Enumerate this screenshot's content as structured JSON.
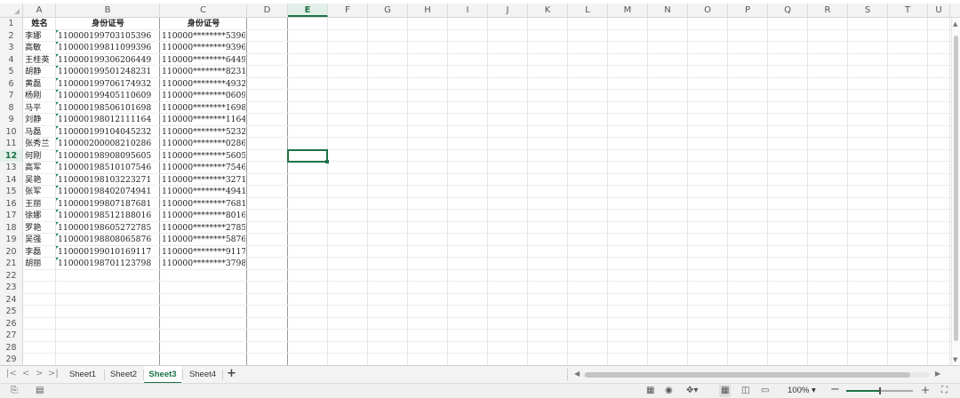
{
  "columns": [
    "A",
    "B",
    "C",
    "D",
    "E",
    "F",
    "G",
    "H",
    "I",
    "J",
    "K",
    "L",
    "M",
    "N",
    "O",
    "P",
    "Q",
    "R",
    "S",
    "T",
    "U"
  ],
  "selected_column": "E",
  "rows": [
    "1",
    "2",
    "3",
    "4",
    "5",
    "6",
    "7",
    "8",
    "9",
    "10",
    "11",
    "12",
    "13",
    "14",
    "15",
    "16",
    "17",
    "18",
    "19",
    "20",
    "21",
    "22",
    "23",
    "24",
    "25",
    "26",
    "27",
    "28",
    "29"
  ],
  "selected_row": "12",
  "headers": {
    "name": "姓名",
    "id_number": "身份证号",
    "masked_id": "身份证号"
  },
  "data_rows": [
    {
      "name": "李娜",
      "id": "110000199703105396",
      "masked": "110000********5396"
    },
    {
      "name": "高敏",
      "id": "110000199811099396",
      "masked": "110000********9396"
    },
    {
      "name": "王桂英",
      "id": "110000199306206449",
      "masked": "110000********6449"
    },
    {
      "name": "胡静",
      "id": "110000199501248231",
      "masked": "110000********8231"
    },
    {
      "name": "黄磊",
      "id": "110000199706174932",
      "masked": "110000********4932"
    },
    {
      "name": "杨刚",
      "id": "110000199405110609",
      "masked": "110000********0609"
    },
    {
      "name": "马平",
      "id": "110000198506101698",
      "masked": "110000********1698"
    },
    {
      "name": "刘静",
      "id": "110000198012111164",
      "masked": "110000********1164"
    },
    {
      "name": "马磊",
      "id": "110000199104045232",
      "masked": "110000********5232"
    },
    {
      "name": "张秀兰",
      "id": "110000200008210286",
      "masked": "110000********0286"
    },
    {
      "name": "何刚",
      "id": "110000198908095605",
      "masked": "110000********5605"
    },
    {
      "name": "高军",
      "id": "110000198510107546",
      "masked": "110000********7546"
    },
    {
      "name": "吴艳",
      "id": "110000198103223271",
      "masked": "110000********3271"
    },
    {
      "name": "张军",
      "id": "110000198402074941",
      "masked": "110000********4941"
    },
    {
      "name": "王丽",
      "id": "110000199807187681",
      "masked": "110000********7681"
    },
    {
      "name": "徐娜",
      "id": "110000198512188016",
      "masked": "110000********8016"
    },
    {
      "name": "罗艳",
      "id": "110000198605272785",
      "masked": "110000********2785"
    },
    {
      "name": "吴强",
      "id": "110000198808065876",
      "masked": "110000********5876"
    },
    {
      "name": "李磊",
      "id": "110000199010169117",
      "masked": "110000********9117"
    },
    {
      "name": "胡丽",
      "id": "110000198701123798",
      "masked": "110000********3798"
    }
  ],
  "sheet_tabs": [
    "Sheet1",
    "Sheet2",
    "Sheet3",
    "Sheet4"
  ],
  "active_sheet": "Sheet3",
  "add_sheet_label": "+",
  "nav_buttons": {
    "first": "|<",
    "prev": "<",
    "next": ">",
    "last": ">|"
  },
  "zoom_label": "100%",
  "zoom_level_percent": 100,
  "zoom_minus": "−",
  "zoom_plus": "+",
  "colors": {
    "accent": "#1e7145",
    "selection_fill": "#e3efe9",
    "header_bg": "#f3f3f3"
  }
}
